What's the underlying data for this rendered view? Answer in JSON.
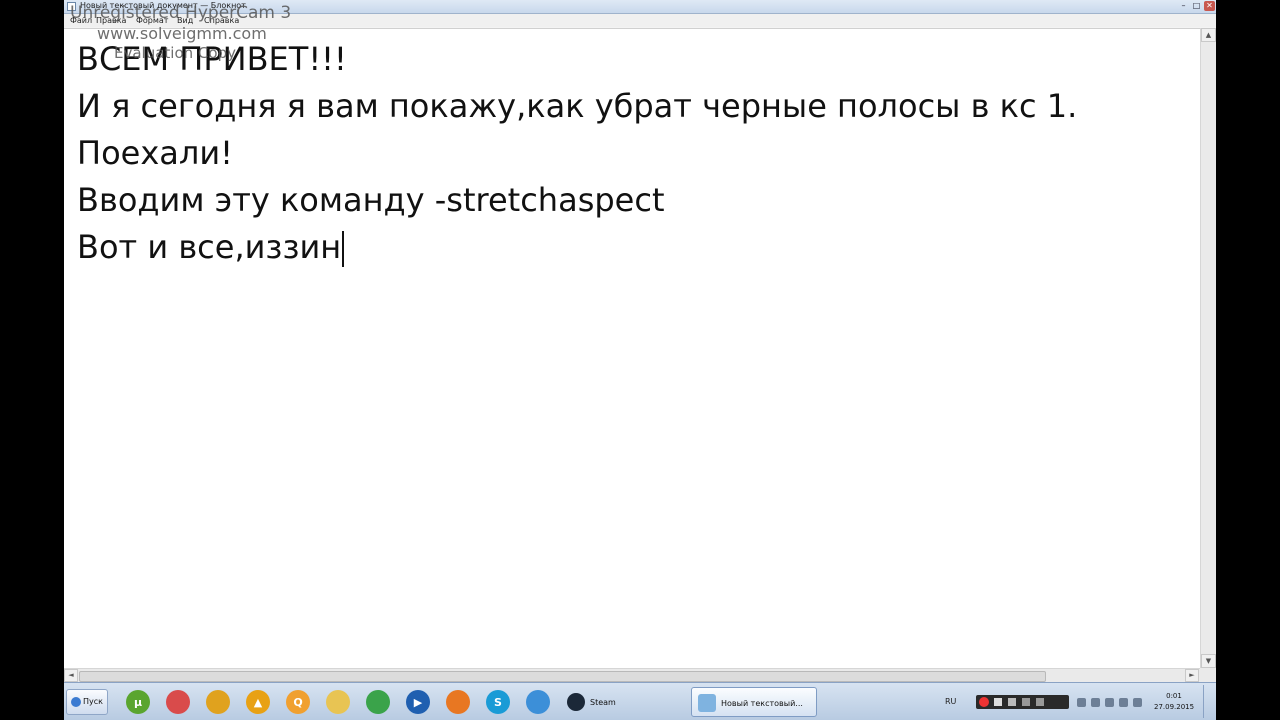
{
  "window": {
    "title": "Новый текстовый документ — Блокнот",
    "controls": {
      "minimize": "–",
      "maximize": "□",
      "close": "✕"
    }
  },
  "menu": [
    "Файл",
    "Правка",
    "Формат",
    "Вид",
    "Справка"
  ],
  "watermark": {
    "line1": "Unregistered HyperCam 3",
    "line2": "www.solveigmm.com",
    "line3": "Evaluation Copy"
  },
  "document": {
    "lines": [
      "ВСЕМ ПРИВЕТ!!!",
      "И я сегодня я вам покажу,как убрат черные полосы в кс 1.",
      "Поехали!",
      "Вводим эту команду -stretchaspect",
      "Вот и все,иззин"
    ]
  },
  "scrollbar": {
    "up_arrow": "▲",
    "down_arrow": "▼",
    "left_arrow": "◄",
    "right_arrow": "►"
  },
  "taskbar": {
    "start_label": "Пуск",
    "pinned_icons": [
      {
        "name": "utorrent-icon",
        "glyph": "µ",
        "color": "#5aa52f"
      },
      {
        "name": "folder-icon",
        "glyph": "",
        "color": "#d94b4b"
      },
      {
        "name": "chrome-icon",
        "glyph": "",
        "color": "#e0a21e"
      },
      {
        "name": "aimp-icon",
        "glyph": "▲",
        "color": "#e8a114"
      },
      {
        "name": "search-app-icon",
        "glyph": "Q",
        "color": "#f0a030"
      },
      {
        "name": "explorer-icon",
        "glyph": "",
        "color": "#e8c453"
      },
      {
        "name": "chrome-2-icon",
        "glyph": "",
        "color": "#3aa34a"
      },
      {
        "name": "media-icon",
        "glyph": "▶",
        "color": "#1f5fb0"
      },
      {
        "name": "firefox-icon",
        "glyph": "",
        "color": "#e87722"
      },
      {
        "name": "skype-icon",
        "glyph": "S",
        "color": "#1a9bd6"
      },
      {
        "name": "globe-icon",
        "glyph": "",
        "color": "#3c8fd8"
      }
    ],
    "tasks": [
      {
        "label": "Steam",
        "icon_color": "#1b2838"
      },
      {
        "label": "Новый текстовый...",
        "icon_color": "#7fb3e0"
      }
    ],
    "language": "RU",
    "clock": {
      "time": "0:01",
      "date": "27.09.2015"
    }
  }
}
